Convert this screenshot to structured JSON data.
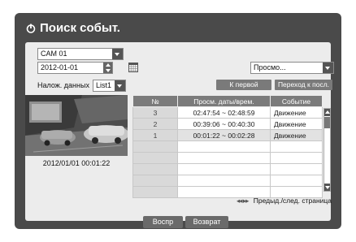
{
  "window": {
    "title": "Поиск событ."
  },
  "camera_select": {
    "value": "CAM 01"
  },
  "date_field": {
    "value": "2012-01-01"
  },
  "search_type": {
    "value": "Просмо..."
  },
  "overlap": {
    "label": "Налож. данных",
    "value": "List1"
  },
  "buttons": {
    "first": "К первой",
    "last": "Переход к посл."
  },
  "preview": {
    "timestamp": "2012/01/01  00:01:22"
  },
  "table": {
    "headers": [
      "№",
      "Просм. даты/врем.",
      "Событие"
    ],
    "rows": [
      {
        "no": "3",
        "time": "02:47:54 ~ 02:48:59",
        "event": "Движение"
      },
      {
        "no": "2",
        "time": "00:39:06 ~ 00:40:30",
        "event": "Движение"
      },
      {
        "no": "1",
        "time": "00:01:22 ~ 00:02:28",
        "event": "Движение"
      }
    ]
  },
  "pager": {
    "label": "Предыд./след. страница"
  },
  "footer": {
    "play": "Воспр",
    "back": "Возврат"
  }
}
